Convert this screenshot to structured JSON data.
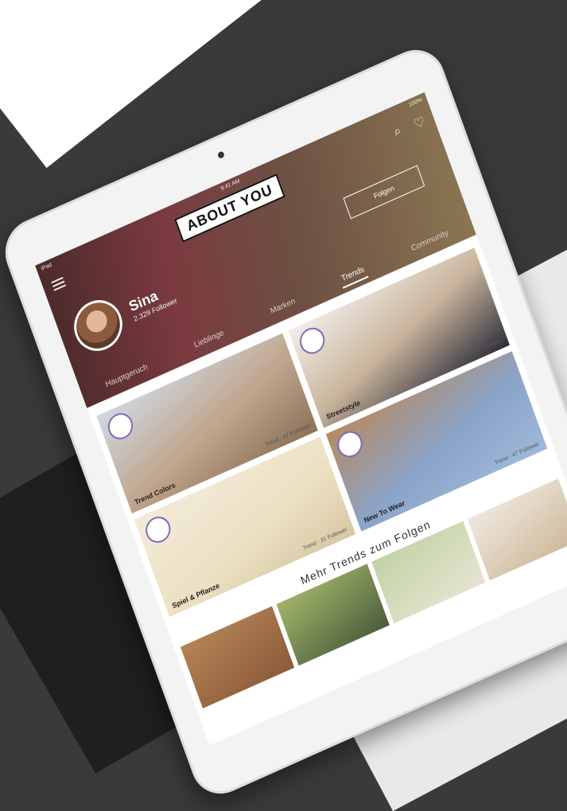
{
  "status_bar": {
    "carrier": "iPad",
    "time": "9:41 AM",
    "battery": "100%"
  },
  "header": {
    "logo": "ABOUT YOU"
  },
  "profile": {
    "name": "Sina",
    "followers": "2.329 Follower",
    "follow_button": "Folgen"
  },
  "tabs": [
    {
      "label": "Hauptgeruch"
    },
    {
      "label": "Lieblinge"
    },
    {
      "label": "Marken"
    },
    {
      "label": "Trends"
    },
    {
      "label": "Community"
    }
  ],
  "cards": [
    {
      "caption": "Trend Colors",
      "meta": "Trend · 47 Follower"
    },
    {
      "caption": "Streetstyle",
      "meta": "Trend · 87 Follower"
    },
    {
      "caption": "Spiel & Pflanze",
      "meta": "Trend · 31 Follower"
    },
    {
      "caption": "New To Wear",
      "meta": "Trend · 47 Follower"
    }
  ],
  "more_section": {
    "title": "Mehr Trends zum Folgen"
  },
  "colors": {
    "accent": "#7d6bb6",
    "header_dark": "#4a2a2a",
    "background": "#3a3a3a"
  },
  "icons": [
    "menu-icon",
    "search-icon",
    "heart-icon"
  ]
}
